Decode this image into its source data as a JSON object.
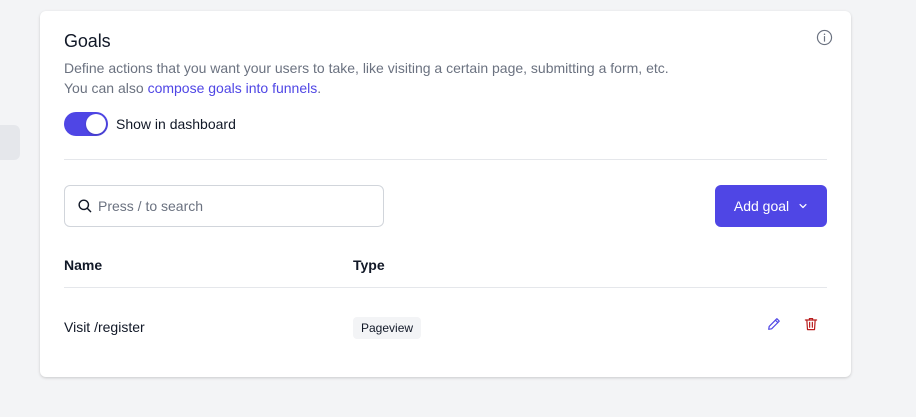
{
  "goals": {
    "title": "Goals",
    "description_line1": "Define actions that you want your users to take, like visiting a certain page, submitting a form, etc.",
    "description_line2_prefix": "You can also ",
    "description_link": "compose goals into funnels",
    "description_suffix": ".",
    "toggle": {
      "label": "Show in dashboard",
      "on": true
    },
    "search": {
      "placeholder": "Press / to search",
      "value": ""
    },
    "add_button": {
      "label": "Add goal"
    },
    "table": {
      "headers": {
        "name": "Name",
        "type": "Type"
      },
      "rows": [
        {
          "name": "Visit /register",
          "type": "Pageview"
        }
      ]
    },
    "icons": {
      "info": "info-icon",
      "search": "search-icon",
      "chevron": "chevron-down-icon",
      "edit": "pencil-icon",
      "delete": "trash-icon"
    },
    "colors": {
      "accent": "#4f46e5",
      "danger": "#b91c1c",
      "muted_text": "#6b7280"
    }
  }
}
